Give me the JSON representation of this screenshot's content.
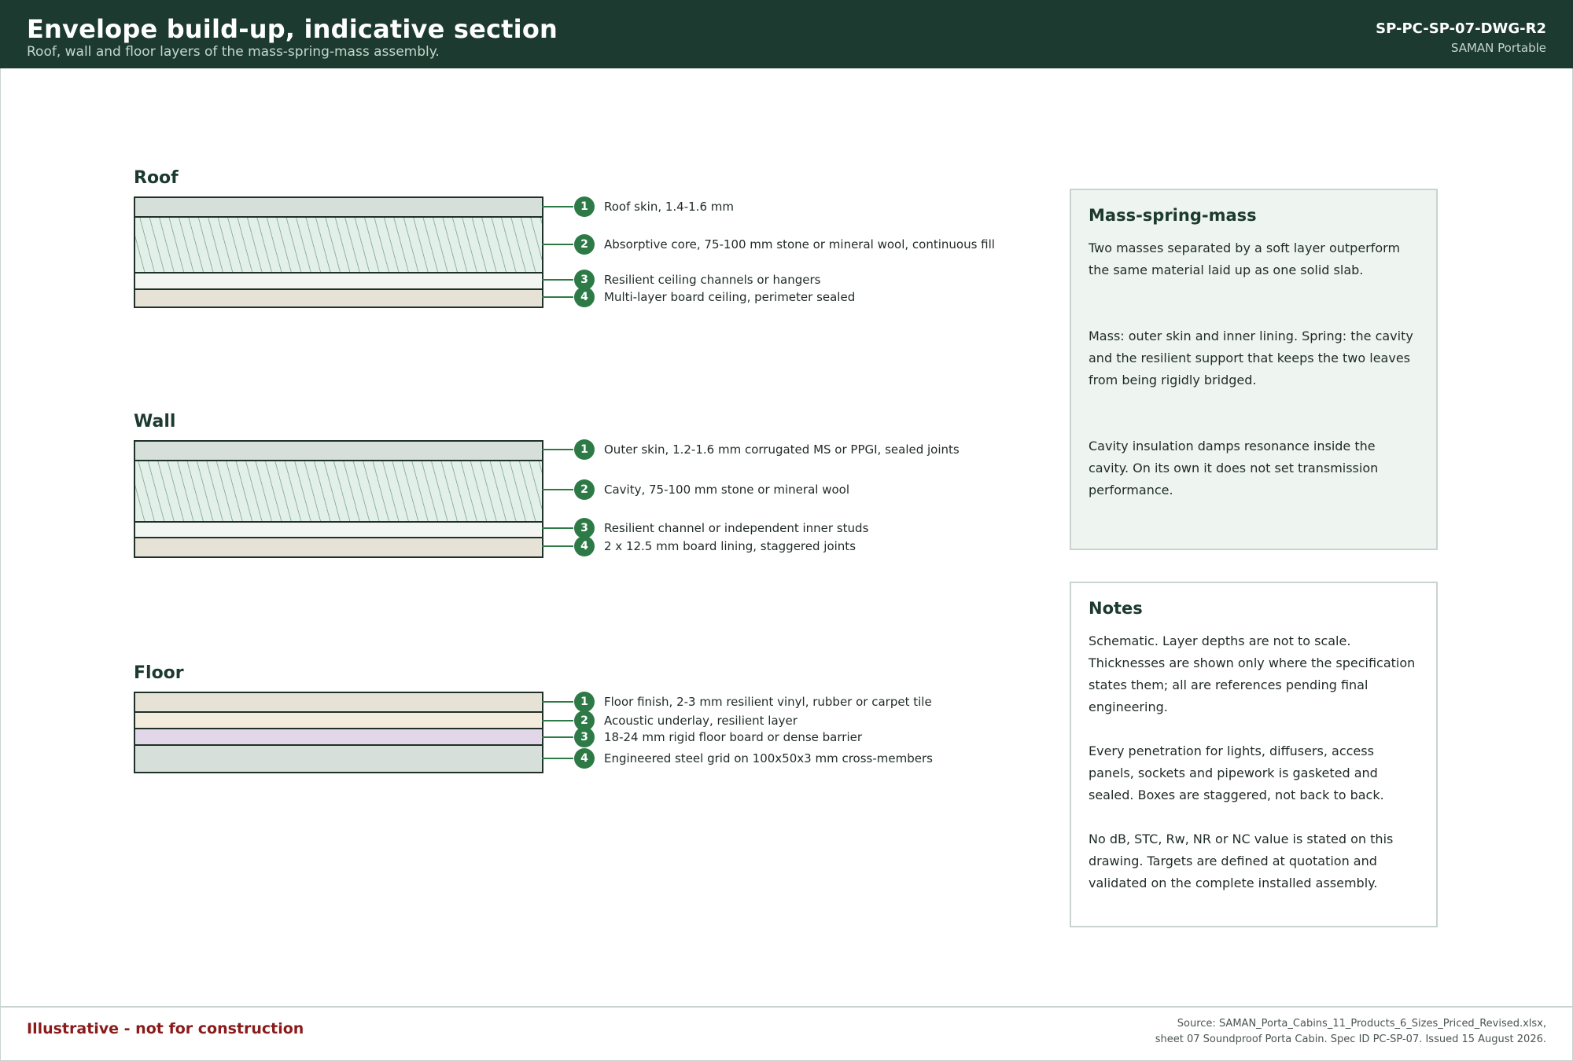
{
  "header": {
    "title": "Envelope build-up, indicative section",
    "subtitle": "Roof, wall and floor layers of the mass-spring-mass assembly.",
    "doc_id": "SP-PC-SP-07-DWG-R2",
    "brand": "SAMAN Portable"
  },
  "sections": {
    "roof": {
      "title": "Roof",
      "layers": [
        {
          "num": "1",
          "label": "Roof skin, 1.4-1.6 mm"
        },
        {
          "num": "2",
          "label": "Absorptive core, 75-100 mm stone or mineral wool, continuous fill"
        },
        {
          "num": "3",
          "label": "Resilient ceiling channels or hangers"
        },
        {
          "num": "4",
          "label": "Multi-layer board ceiling, perimeter sealed"
        }
      ]
    },
    "wall": {
      "title": "Wall",
      "layers": [
        {
          "num": "1",
          "label": "Outer skin, 1.2-1.6 mm corrugated MS or PPGI, sealed joints"
        },
        {
          "num": "2",
          "label": "Cavity, 75-100 mm stone or mineral wool"
        },
        {
          "num": "3",
          "label": "Resilient channel or independent inner studs"
        },
        {
          "num": "4",
          "label": "2 x 12.5 mm board lining, staggered joints"
        }
      ]
    },
    "floor": {
      "title": "Floor",
      "layers": [
        {
          "num": "1",
          "label": "Floor finish, 2-3 mm resilient vinyl, rubber or carpet tile"
        },
        {
          "num": "2",
          "label": "Acoustic underlay, resilient layer"
        },
        {
          "num": "3",
          "label": "18-24 mm rigid floor board or dense barrier"
        },
        {
          "num": "4",
          "label": "Engineered steel grid on 100x50x3 mm cross-members"
        }
      ]
    }
  },
  "msm_panel": {
    "title": "Mass-spring-mass",
    "paragraphs": [
      "Two masses separated by a soft layer outperform the same material laid up as one solid slab.",
      "Mass: outer skin and inner lining. Spring: the cavity and the resilient support that keeps the two leaves from being rigidly bridged.",
      "Cavity insulation damps resonance inside the cavity. On its own it does not set transmission performance."
    ]
  },
  "notes_panel": {
    "title": "Notes",
    "paragraphs": [
      "Schematic. Layer depths are not to scale. Thicknesses are shown only where the specification states them; all are references pending final engineering.",
      "Every penetration for lights, diffusers, access panels, sockets and pipework is gasketed and sealed. Boxes are staggered, not back to back.",
      "No dB, STC, Rw, NR or NC value is stated on this drawing. Targets are defined at quotation and validated on the complete installed assembly."
    ]
  },
  "footer": {
    "disclaimer": "Illustrative - not for construction",
    "source_line1": "Source: SAMAN_Porta_Cabins_11_Products_6_Sizes_Priced_Revised.xlsx,",
    "source_line2": "sheet 07 Soundproof Porta Cabin. Spec ID PC-SP-07. Issued 15 August 2026."
  },
  "colors": {
    "brand_dark": "#1c3a2f",
    "accent_green": "#2e7a47",
    "warning_red": "#8b1a1a"
  }
}
